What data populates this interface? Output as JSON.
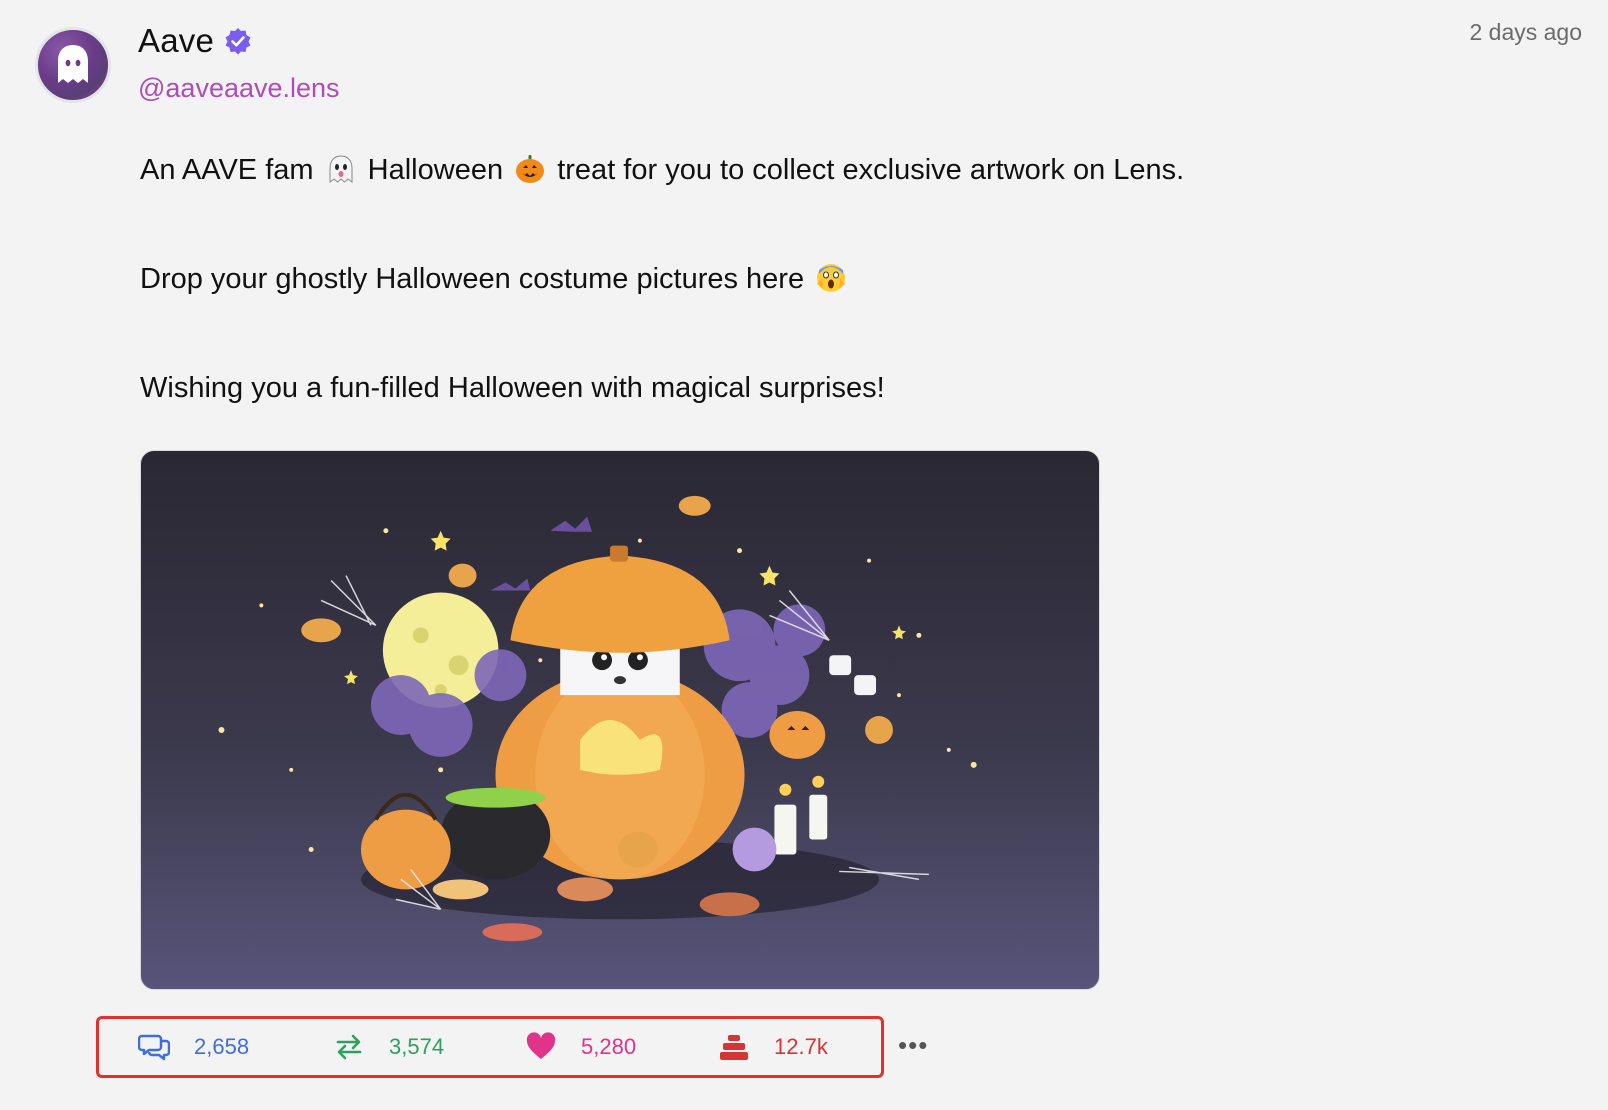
{
  "post": {
    "author_name": "Aave",
    "author_handle": "@aaveaave.lens",
    "timestamp": "2 days ago",
    "content": {
      "line1_part1": "An AAVE fam",
      "line1_part2": "Halloween",
      "line1_part3": "treat for you to collect exclusive artwork on Lens.",
      "line2_part1": "Drop your ghostly Halloween costume pictures here",
      "line3": "Wishing you a fun-filled Halloween with magical surprises!"
    },
    "actions": {
      "comments": "2,658",
      "mirrors": "3,574",
      "likes": "5,280",
      "collects": "12.7k",
      "more": "•••"
    }
  },
  "icons": {
    "verified": "verified-badge-icon",
    "comment": "comment-icon",
    "mirror": "mirror-icon",
    "like": "heart-icon",
    "collect": "collect-icon"
  },
  "colors": {
    "handle": "#b04bb8",
    "comment": "#3f6fd6",
    "mirror": "#2ea05e",
    "like": "#e0338a",
    "collect": "#d63535",
    "highlight_border": "#e0322a",
    "verified": "#7b5cf0"
  }
}
